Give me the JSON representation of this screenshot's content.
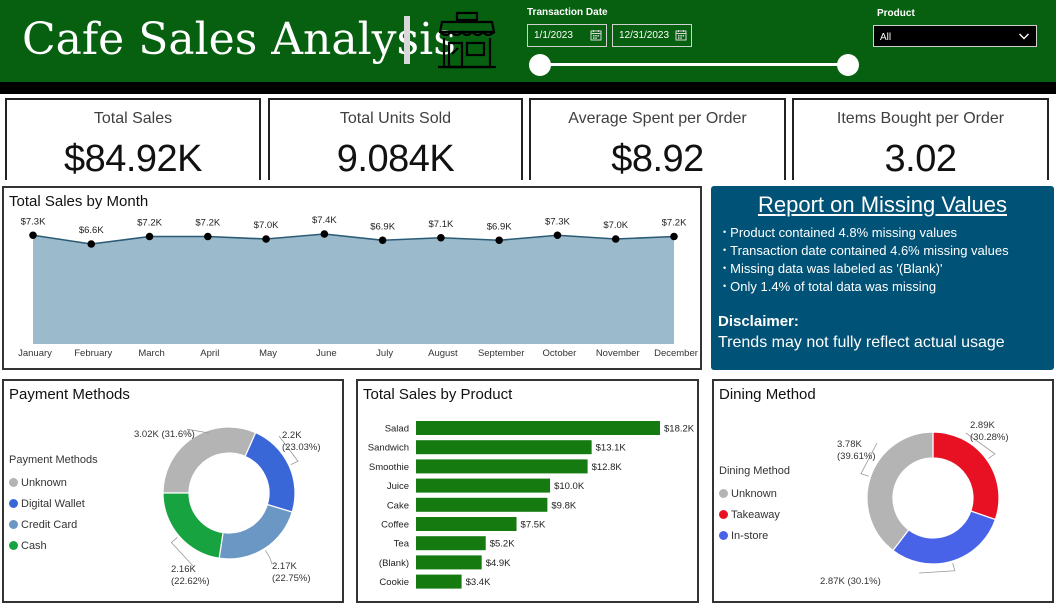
{
  "header": {
    "title": "Cafe Sales Analysis",
    "date_filter_label": "Transaction Date",
    "start_date": "1/1/2023",
    "end_date": "12/31/2023",
    "product_filter_label": "Product",
    "product_value": "All",
    "colors": {
      "background": "#06600f",
      "bar": "#000000"
    }
  },
  "kpis": [
    {
      "label": "Total Sales",
      "value": "$84.92K"
    },
    {
      "label": "Total Units Sold",
      "value": "9.084K"
    },
    {
      "label": "Average Spent per Order",
      "value": "$8.92"
    },
    {
      "label": "Items Bought per Order",
      "value": "3.02"
    }
  ],
  "report": {
    "title": "Report on Missing Values",
    "items": [
      "Product contained 4.8% missing values",
      "Transaction date contained 4.6% missing values",
      "Missing data was labeled as '(Blank)'",
      "Only 1.4% of total data was missing"
    ],
    "disclaimer_title": "Disclaimer:",
    "disclaimer_text": "Trends may not fully reflect actual usage",
    "color": "#015277"
  },
  "chart_data": [
    {
      "type": "area",
      "title": "Total Sales by Month",
      "categories": [
        "January",
        "February",
        "March",
        "April",
        "May",
        "June",
        "July",
        "August",
        "September",
        "October",
        "November",
        "December"
      ],
      "values": [
        7.3,
        6.6,
        7.2,
        7.2,
        7.0,
        7.4,
        6.9,
        7.1,
        6.9,
        7.3,
        7.0,
        7.2
      ],
      "data_labels": [
        "$7.3K",
        "$6.6K",
        "$7.2K",
        "$7.2K",
        "$7.0K",
        "$7.4K",
        "$6.9K",
        "$7.1K",
        "$6.9K",
        "$7.3K",
        "$7.0K",
        "$7.2K"
      ],
      "unit": "K",
      "ylim": [
        0,
        7.4
      ],
      "grid": false,
      "colors": {
        "fill": "#9bbacb",
        "line": "#2b5b75",
        "point": "#000000"
      }
    },
    {
      "type": "pie",
      "variant": "donut",
      "title": "Payment Methods",
      "legend_title": "Payment Methods",
      "legend_position": "left",
      "slices": [
        {
          "name": "Unknown",
          "value": 3.02,
          "label": "3.02K (31.6%)",
          "color": "#b4b4b4"
        },
        {
          "name": "Digital Wallet",
          "value": 2.2,
          "label": "2.2K (23.03%)",
          "color": "#3a67d8"
        },
        {
          "name": "Credit Card",
          "value": 2.17,
          "label": "2.17K (22.75%)",
          "color": "#6a97c4"
        },
        {
          "name": "Cash",
          "value": 2.16,
          "label": "2.16K (22.62%)",
          "color": "#17a340"
        }
      ]
    },
    {
      "type": "bar",
      "orientation": "horizontal",
      "title": "Total Sales by Product",
      "categories": [
        "Salad",
        "Sandwich",
        "Smoothie",
        "Juice",
        "Cake",
        "Coffee",
        "Tea",
        "(Blank)",
        "Cookie"
      ],
      "values": [
        18.2,
        13.1,
        12.8,
        10.0,
        9.8,
        7.5,
        5.2,
        4.9,
        3.4
      ],
      "data_labels": [
        "$18.2K",
        "$13.1K",
        "$12.8K",
        "$10.0K",
        "$9.8K",
        "$7.5K",
        "$5.2K",
        "$4.9K",
        "$3.4K"
      ],
      "unit": "K",
      "grid": false,
      "color": "#157a10"
    },
    {
      "type": "pie",
      "variant": "donut",
      "title": "Dining Method",
      "legend_title": "Dining Method",
      "legend_position": "left",
      "slices": [
        {
          "name": "Takeaway",
          "value": 2.89,
          "label": "2.89K (30.28%)",
          "color": "#e81123"
        },
        {
          "name": "In-store",
          "value": 2.87,
          "label": "2.87K (30.1%)",
          "color": "#4963e8"
        },
        {
          "name": "Unknown",
          "value": 3.78,
          "label": "3.78K (39.61%)",
          "color": "#b4b4b4"
        }
      ],
      "legend_order": [
        "Unknown",
        "Takeaway",
        "In-store"
      ]
    }
  ]
}
